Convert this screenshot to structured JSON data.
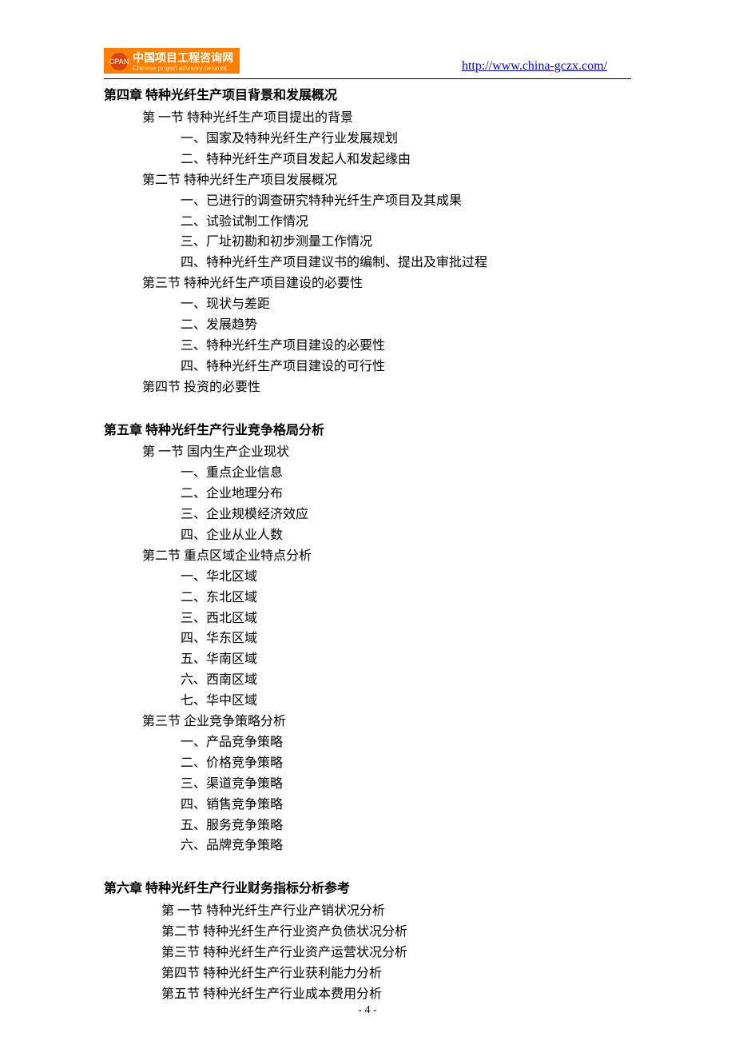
{
  "header": {
    "logo_cn": "中国项目工程咨询网",
    "logo_en": "Chinese project advisory network",
    "logo_mark": "CPAN",
    "url": "http://www.china-gczx.com/"
  },
  "chapters": [
    {
      "title": "第四章  特种光纤生产项目背景和发展概况",
      "sections": [
        {
          "title": "第 一节  特种光纤生产项目提出的背景",
          "items": [
            "一、国家及特种光纤生产行业发展规划",
            "二、特种光纤生产项目发起人和发起缘由"
          ]
        },
        {
          "title": "第二节   特种光纤生产项目发展概况",
          "items": [
            "一、已进行的调查研究特种光纤生产项目及其成果",
            "二、试验试制工作情况",
            "三、厂址初勘和初步测量工作情况",
            "四、特种光纤生产项目建议书的编制、提出及审批过程"
          ]
        },
        {
          "title": "第三节   特种光纤生产项目建设的必要性",
          "items": [
            "一、现状与差距",
            "二、发展趋势",
            "三、特种光纤生产项目建设的必要性",
            "四、特种光纤生产项目建设的可行性"
          ]
        },
        {
          "title": "第四节    投资的必要性",
          "items": []
        }
      ]
    },
    {
      "title": "第五章  特种光纤生产行业竞争格局分析",
      "sections": [
        {
          "title": "第 一节    国内生产企业现状",
          "items": [
            "一、重点企业信息",
            "二、企业地理分布",
            "三、企业规模经济效应",
            "四、企业从业人数"
          ]
        },
        {
          "title": "第二节    重点区域企业特点分析",
          "items": [
            "一、华北区域",
            "二、东北区域",
            "三、西北区域",
            "四、华东区域",
            "五、华南区域",
            "六、西南区域",
            "七、华中区域"
          ]
        },
        {
          "title": "第三节    企业竞争策略分析",
          "items": [
            "一、产品竞争策略",
            "二、价格竞争策略",
            "三、渠道竞争策略",
            "四、销售竞争策略",
            "五、服务竞争策略",
            "六、品牌竞争策略"
          ]
        }
      ]
    },
    {
      "title": "第六章  特种光纤生产行业财务指标分析参考",
      "sub_sections": [
        "第 一节  特种光纤生产行业产销状况分析",
        "第二节   特种光纤生产行业资产负债状况分析",
        "第三节   特种光纤生产行业资产运营状况分析",
        "第四节   特种光纤生产行业获利能力分析",
        "第五节   特种光纤生产行业成本费用分析"
      ]
    }
  ],
  "page_number": "- 4 -"
}
